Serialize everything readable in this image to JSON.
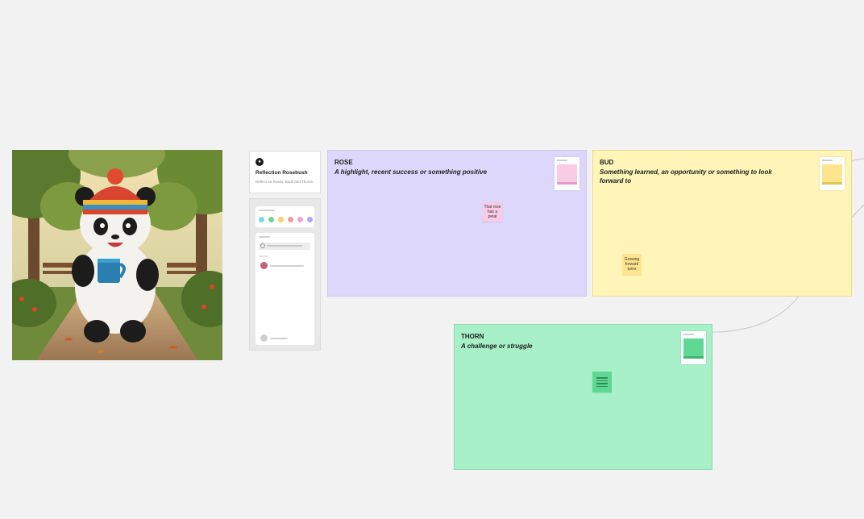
{
  "colors": {
    "canvas": "#f2f2f2",
    "rose_bg": "#ddd8fb",
    "bud_bg": "#fff5b8",
    "thorn_bg": "#a8f0c8",
    "rose_sticky": "#f9cbe4",
    "bud_sticky": "#fde58e",
    "thorn_sticky": "#5fd893"
  },
  "image": {
    "subject": "panda-with-mug-illustration"
  },
  "template_card": {
    "logo_glyph": "●",
    "title": "Reflection Rosebush",
    "subtitle": "Reflect on Roses, Buds and Thorns"
  },
  "palette": {
    "dots": [
      "#7ed6e6",
      "#6fd39a",
      "#f6d36a",
      "#f49a9a",
      "#f2a0d8",
      "#b3a3f2"
    ]
  },
  "frames": {
    "rose": {
      "title": "ROSE",
      "description": "A highlight, recent success or something positive",
      "sticky": "That rose has a petal"
    },
    "bud": {
      "title": "BUD",
      "description": "Something learned, an opportunity or something to look forward to",
      "sticky": "Growing forward turns"
    },
    "thorn": {
      "title": "THORN",
      "description": "A challenge or struggle"
    }
  }
}
